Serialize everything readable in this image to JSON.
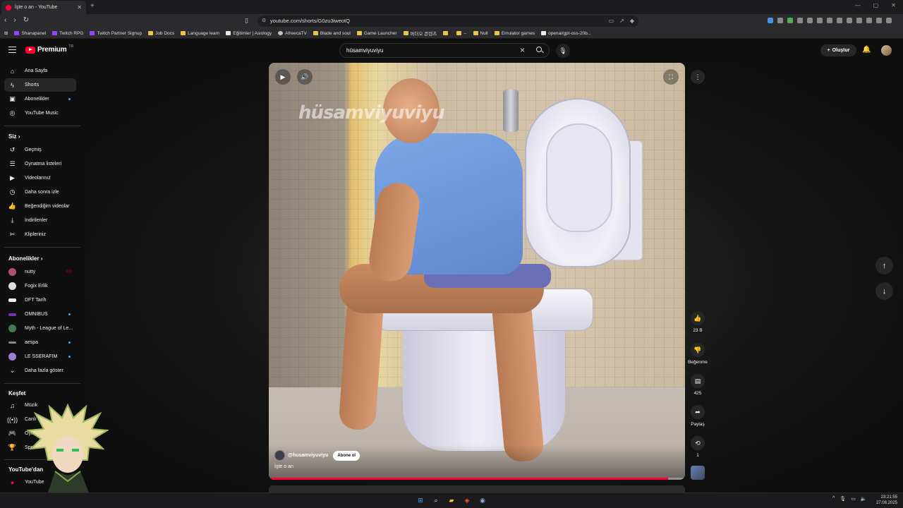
{
  "browser": {
    "tab_title": "İşte o an - YouTube",
    "url": "youtube.com/shorts/G0zu3iweotQ",
    "bookmarks": [
      "Shanapanel",
      "Twitch RPG",
      "Twitch Partner Signup",
      "Job Docs",
      "Language learn",
      "Eğitimler | Asiology",
      "AfreecaTV",
      "Blade and soul",
      "Game Launcher",
      "버더오 콘텐츠",
      "",
      "--",
      "Null",
      "Emulator games",
      "openai/gpt-oss-20b..."
    ]
  },
  "header": {
    "logo_text": "Premium",
    "region": "TR",
    "search_value": "hüsamviyuviyu",
    "create_label": "Oluştur"
  },
  "sidebar": {
    "main": [
      {
        "label": "Ana Sayfa",
        "icon": "home-icon"
      },
      {
        "label": "Shorts",
        "icon": "shorts-icon",
        "active": true
      },
      {
        "label": "Abonelikler",
        "icon": "subscriptions-icon",
        "dot": true
      },
      {
        "label": "YouTube Music",
        "icon": "music-icon"
      }
    ],
    "you_heading": "Siz",
    "you": [
      {
        "label": "Geçmiş",
        "icon": "history-icon"
      },
      {
        "label": "Oynatma listeleri",
        "icon": "playlist-icon"
      },
      {
        "label": "Videolarınız",
        "icon": "your-videos-icon"
      },
      {
        "label": "Daha sonra izle",
        "icon": "watch-later-icon"
      },
      {
        "label": "Beğendiğim videolar",
        "icon": "liked-icon"
      },
      {
        "label": "İndirilenler",
        "icon": "download-icon"
      },
      {
        "label": "Klipleriniz",
        "icon": "clips-icon"
      }
    ],
    "subs_heading": "Abonelikler",
    "subs": [
      {
        "label": "nutty",
        "color": "#b5506a",
        "live": true
      },
      {
        "label": "Fogix Erlik",
        "color": "#ddd"
      },
      {
        "label": "DFT Tarih",
        "color": "#eee"
      },
      {
        "label": "OMNIBUS",
        "color": "#7b2fbf",
        "dot": true
      },
      {
        "label": "Myth - League of Le...",
        "color": "#3f7d4a"
      },
      {
        "label": "aespa",
        "color": "#888",
        "dot": true
      },
      {
        "label": "LE SSERAFIM",
        "color": "#9d7fd9",
        "dot": true
      },
      {
        "label": "Daha fazla göster",
        "icon": "chevron-down-icon"
      }
    ],
    "explore_heading": "Keşfet",
    "explore": [
      {
        "label": "Müzik",
        "icon": "music-note-icon"
      },
      {
        "label": "Canlı",
        "icon": "live-icon"
      },
      {
        "label": "Oyun",
        "icon": "gaming-icon"
      },
      {
        "label": "Spor",
        "icon": "trophy-icon"
      }
    ],
    "more_heading": "YouTube'dan",
    "more": [
      {
        "label": "YouTube",
        "icon": "youtube-icon"
      }
    ]
  },
  "short": {
    "watermark": "hüsamviyuviyu",
    "channel": "@husamviyuviyu",
    "subscribe_label": "Abone ol",
    "caption": "İşte o an",
    "progress": 0.96
  },
  "actions": {
    "likes": "23 B",
    "dislike_label": "Beğenme",
    "comments": "425",
    "share_label": "Paylaş",
    "remix_count": "1"
  },
  "taskbar": {
    "time": "23:21:55",
    "date": "27.08.2025"
  },
  "colors": {
    "accent": "#ff0033",
    "bg": "#0f0f0f"
  }
}
